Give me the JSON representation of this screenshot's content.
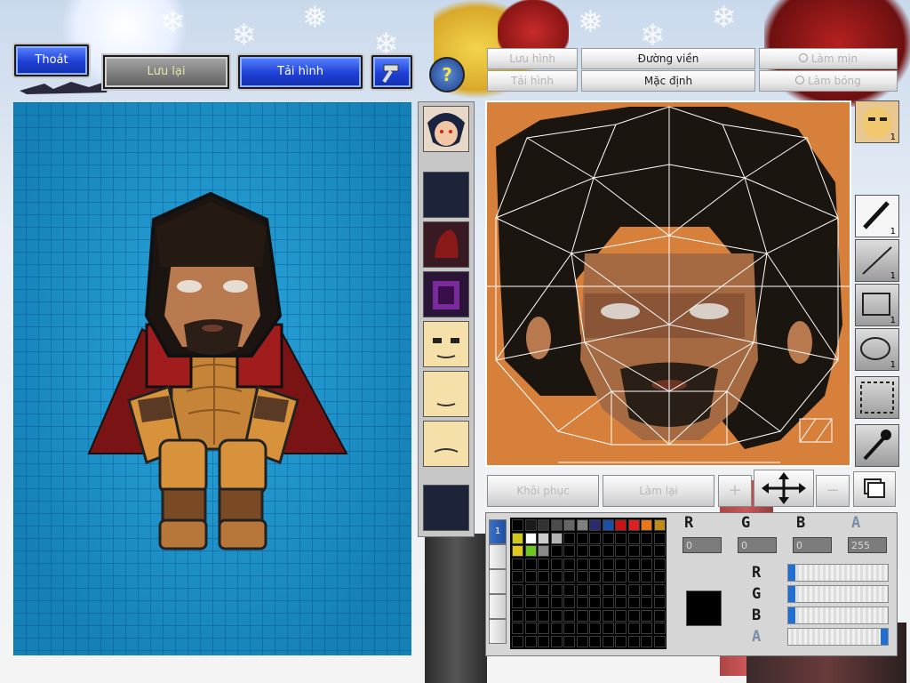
{
  "top_buttons": {
    "exit": "Thoát",
    "save": "Lưu lại",
    "reload": "Tải hình"
  },
  "editor_tabs": {
    "save_image": "Lưu hình",
    "load_image": "Tải hình",
    "outline": "Đường viền",
    "default": "Mặc định",
    "smooth": "Làm mịn",
    "shade": "Làm bóng"
  },
  "tools": {
    "face_count": "1",
    "pen_count": "1",
    "line_count": "1",
    "rect_count": "1",
    "ellipse_count": "1"
  },
  "actions": {
    "restore": "Khôi phục",
    "redo": "Làm lại"
  },
  "color": {
    "r_value": "0",
    "g_value": "0",
    "b_value": "0",
    "a_value": "255",
    "r_label": "R",
    "g_label": "G",
    "b_label": "B",
    "a_label": "A",
    "current": "#000000",
    "palette_row1": [
      "#000000",
      "#1a1a1a",
      "#333333",
      "#4d4d4d",
      "#666666",
      "#808080",
      "#2a2a6e",
      "#1c4fa8",
      "#c81414",
      "#e02020",
      "#e8761c",
      "#c08a1c"
    ],
    "palette_row2": [
      "#cfc81c",
      "#ffffff",
      "#cccccc",
      "#b3b3b3"
    ],
    "palette_row3": [
      "#e0c81c",
      "#6cc81c",
      "#8a8a8a"
    ],
    "slider_r": 0,
    "slider_g": 0,
    "slider_b": 0,
    "slider_a": 1
  },
  "side_tab_number": "1",
  "help_icon_label": "?"
}
